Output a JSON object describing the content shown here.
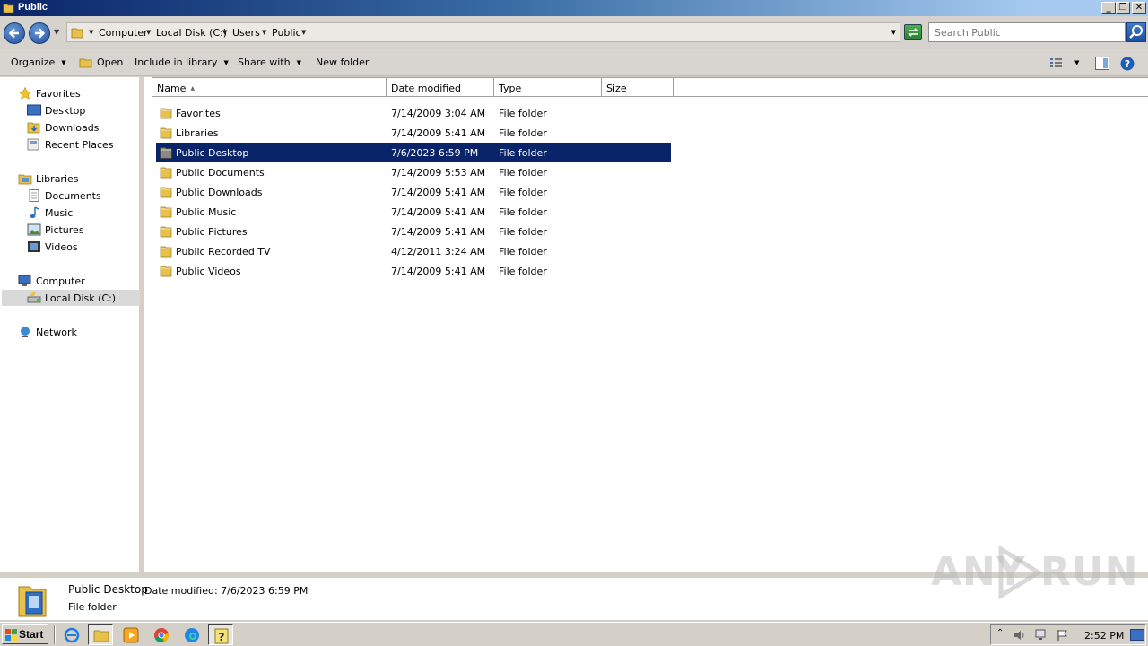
{
  "window": {
    "title": "Public",
    "minimize_label": "_",
    "restore_label": "❐",
    "close_label": "✕"
  },
  "address": {
    "crumbs": [
      "Computer",
      "Local Disk (C:)",
      "Users",
      "Public"
    ],
    "search_placeholder": "Search Public"
  },
  "toolbar": {
    "organize": "Organize",
    "open": "Open",
    "include_in_library": "Include in library",
    "share_with": "Share with",
    "new_folder": "New folder"
  },
  "sidebar": {
    "favorites": "Favorites",
    "favorites_items": [
      "Desktop",
      "Downloads",
      "Recent Places"
    ],
    "libraries": "Libraries",
    "libraries_items": [
      "Documents",
      "Music",
      "Pictures",
      "Videos"
    ],
    "computer": "Computer",
    "computer_items": [
      "Local Disk (C:)"
    ],
    "network": "Network"
  },
  "columns": {
    "name": "Name",
    "date_modified": "Date modified",
    "type": "Type",
    "size": "Size"
  },
  "files": [
    {
      "name": "Favorites",
      "date": "7/14/2009 3:04 AM",
      "type": "File folder"
    },
    {
      "name": "Libraries",
      "date": "7/14/2009 5:41 AM",
      "type": "File folder"
    },
    {
      "name": "Public Desktop",
      "date": "7/6/2023 6:59 PM",
      "type": "File folder"
    },
    {
      "name": "Public Documents",
      "date": "7/14/2009 5:53 AM",
      "type": "File folder"
    },
    {
      "name": "Public Downloads",
      "date": "7/14/2009 5:41 AM",
      "type": "File folder"
    },
    {
      "name": "Public Music",
      "date": "7/14/2009 5:41 AM",
      "type": "File folder"
    },
    {
      "name": "Public Pictures",
      "date": "7/14/2009 5:41 AM",
      "type": "File folder"
    },
    {
      "name": "Public Recorded TV",
      "date": "4/12/2011 3:24 AM",
      "type": "File folder"
    },
    {
      "name": "Public Videos",
      "date": "7/14/2009 5:41 AM",
      "type": "File folder"
    }
  ],
  "selected_file": "Public Desktop",
  "details": {
    "name": "Public Desktop",
    "date_label": "Date modified: 7/6/2023 6:59 PM",
    "type": "File folder"
  },
  "watermark": "ANY RUN",
  "taskbar": {
    "start": "Start",
    "clock": "2:52 PM"
  },
  "colors": {
    "selection": "#0a246a",
    "window_chrome": "#d4d0c8",
    "folder_yellow": "#e8c14a"
  }
}
